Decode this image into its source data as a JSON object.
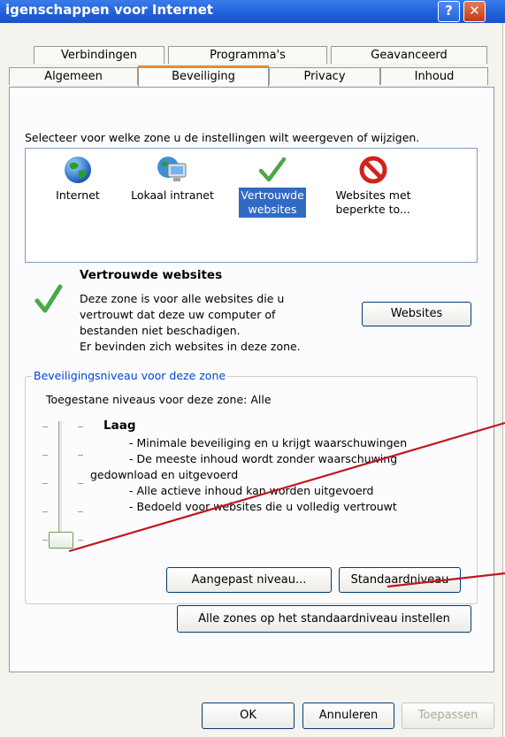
{
  "window": {
    "title": "igenschappen voor Internet",
    "help_icon": "?",
    "close_icon": "✕"
  },
  "tabs_row1": [
    "Verbindingen",
    "Programma's",
    "Geavanceerd"
  ],
  "tabs_row2": [
    "Algemeen",
    "Beveiliging",
    "Privacy",
    "Inhoud"
  ],
  "active_tab": "Beveiliging",
  "zone_prompt": "Selecteer voor welke zone u de instellingen wilt weergeven of wijzigen.",
  "zones": [
    {
      "icon": "globe-icon",
      "label_line1": "Internet",
      "label_line2": ""
    },
    {
      "icon": "intranet-computer-icon",
      "label_line1": "Lokaal intranet",
      "label_line2": ""
    },
    {
      "icon": "green-checkmark-icon",
      "label_line1": "Vertrouwde",
      "label_line2": "websites"
    },
    {
      "icon": "restricted-sign-icon",
      "label_line1": "Websites met",
      "label_line2": "beperkte to..."
    }
  ],
  "selected_zone": {
    "title": "Vertrouwde websites",
    "desc1": "Deze zone is voor alle websites die u",
    "desc2": "vertrouwt dat deze uw computer of",
    "desc3": "bestanden niet beschadigen.",
    "desc4": "Er bevinden zich websites in deze zone.",
    "websites_button": "Websites"
  },
  "security_level": {
    "group_title": "Beveiligingsniveau voor deze zone",
    "allowed": "Toegestane niveaus voor deze zone: Alle",
    "level_name": "Laag",
    "bullet1": "- Minimale beveiliging en u krijgt waarschuwingen",
    "bullet2a": "- De meeste inhoud wordt zonder waarschuwing",
    "bullet2b": "gedownload en uitgevoerd",
    "bullet3": "- Alle actieve inhoud kan worden uitgevoerd",
    "bullet4": "- Bedoeld voor websites die u volledig vertrouwt",
    "slider_level": 0,
    "custom_button": "Aangepast niveau...",
    "default_button": "Standaardniveau"
  },
  "all_zones_button": "Alle zones op het standaardniveau instellen",
  "footer": {
    "ok": "OK",
    "cancel": "Annuleren",
    "apply": "Toepassen"
  },
  "colors": {
    "selection": "#316ac5",
    "group_title": "#0046d5",
    "annotation_line": "#c0161e",
    "tab_accent": "#e68b2c"
  }
}
